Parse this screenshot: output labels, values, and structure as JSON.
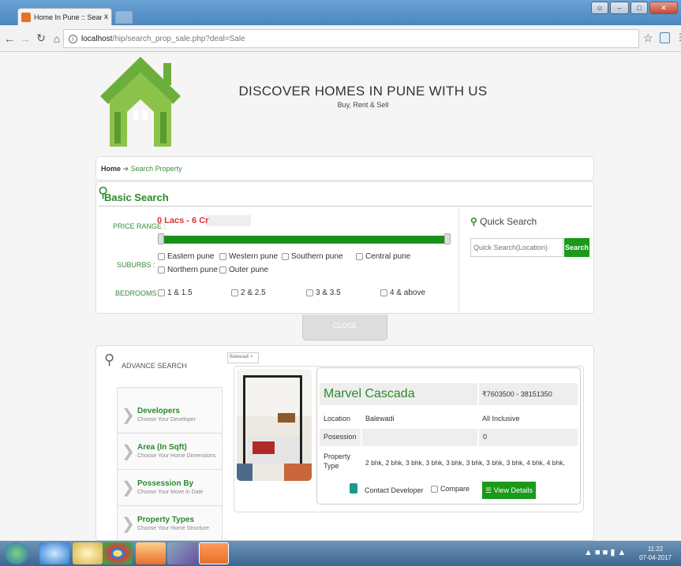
{
  "browser": {
    "tab_title": "Home In Pune :: Search F",
    "tab_close": "x",
    "url_host": "localhost",
    "url_path": "/hip/search_prop_sale.php?deal=Sale"
  },
  "header": {
    "title": "DISCOVER HOMES IN PUNE WITH US",
    "subtitle": "Buy, Rent & Sell"
  },
  "breadcrumb": {
    "home": "Home",
    "current": "Search Property"
  },
  "basic_search": {
    "title": "Basic Search",
    "price_label": "PRICE RANGE :",
    "price_value": "0 Lacs - 6 Cr",
    "suburbs_label": "SUBURBS :",
    "suburbs": [
      "Eastern pune",
      "Western pune",
      "Southern pune",
      "Central pune",
      "Northern pune",
      "Outer pune"
    ],
    "bedrooms_label": "BEDROOMS :",
    "bedrooms": [
      "1 & 1.5",
      "2 & 2.5",
      "3 & 3.5",
      "4 & above"
    ],
    "close": "CLOSE"
  },
  "quick_search": {
    "title": "Quick Search",
    "placeholder": "Quick Search(Location)",
    "button": "Search"
  },
  "advance": {
    "title": "ADVANCE SEARCH",
    "chip": "Balewadi",
    "chip_x": "×",
    "items": [
      {
        "title": "Developers",
        "sub": "Choose Your Developer"
      },
      {
        "title": "Area (In Sqft)",
        "sub": "Choose Your Home Dimensions"
      },
      {
        "title": "Possession By",
        "sub": "Choose Your Move in Date"
      },
      {
        "title": "Property Types",
        "sub": "Choose Your Home Structure"
      }
    ]
  },
  "property": {
    "name": "Marvel Cascada",
    "price": "₹7603500 - 38151350",
    "location_label": "Location",
    "location": "Balewadi",
    "inclusive": "All Inclusive",
    "posession_label": "Posession",
    "posession_value": "0",
    "type_label_1": "Property",
    "type_label_2": "Type",
    "type": "2 bhk, 2 bhk, 3 bhk, 3 bhk, 3 bhk, 3 bhk, 3 bhk, 3 bhk, 4 bhk, 4 bhk,",
    "contact": "Contact Developer",
    "compare": "Compare",
    "view": "View Details"
  },
  "taskbar": {
    "time": "11:22",
    "date": "07-04-2017"
  }
}
